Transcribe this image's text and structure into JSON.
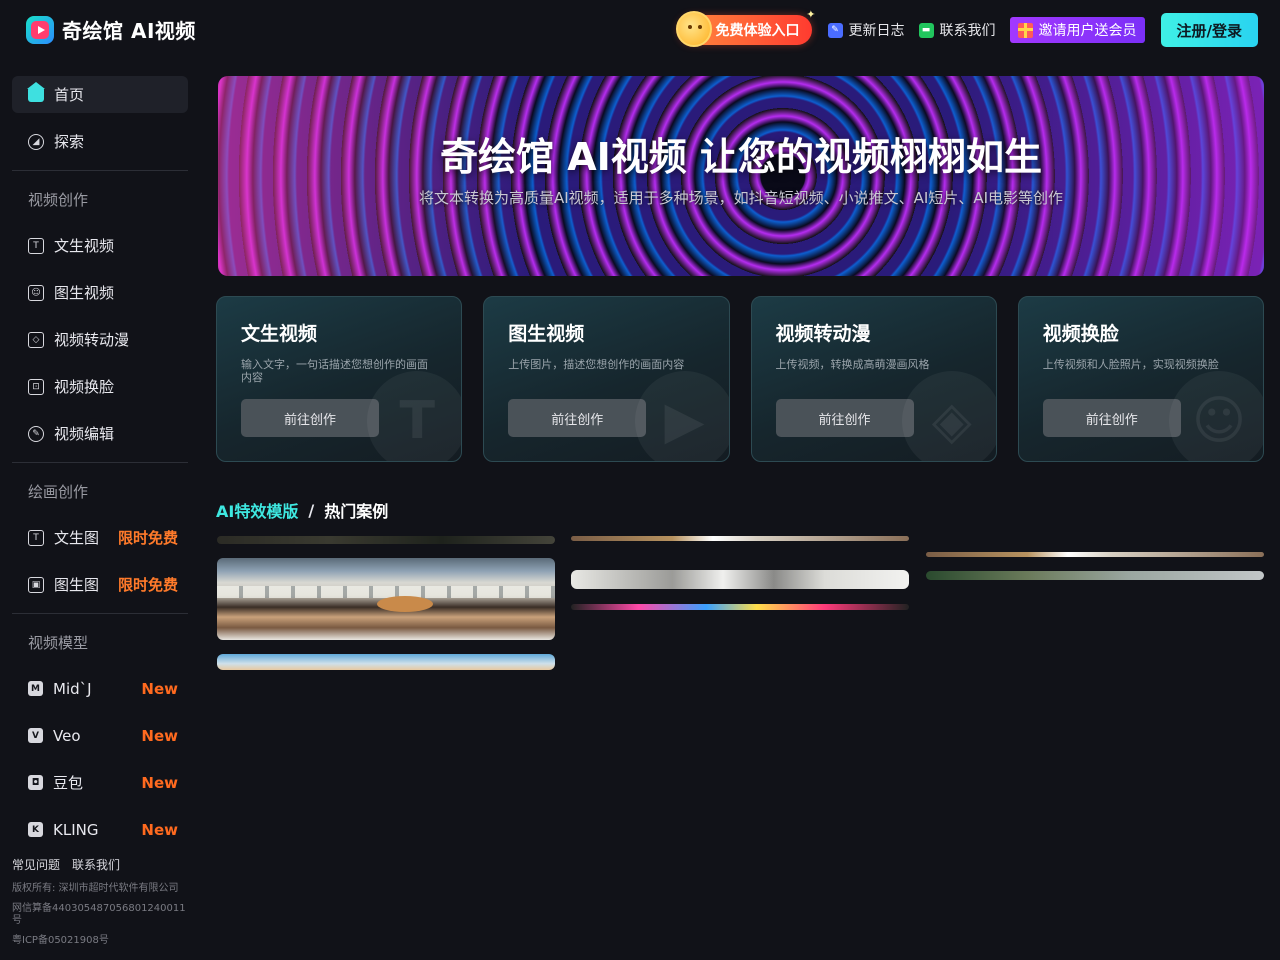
{
  "header": {
    "logo_text": "奇绘馆 AI视频",
    "free_entry": "免费体验入口",
    "changelog": "更新日志",
    "contact": "联系我们",
    "invite": "邀请用户送会员",
    "login": "注册/登录"
  },
  "sidebar": {
    "top_items": [
      {
        "label": "首页",
        "icon": "home-icon",
        "active": true
      },
      {
        "label": "探索",
        "icon": "compass-icon"
      }
    ],
    "video_heading": "视频创作",
    "video_items": [
      {
        "label": "文生视频",
        "icon": "text-t-icon"
      },
      {
        "label": "图生视频",
        "icon": "image-icon"
      },
      {
        "label": "视频转动漫",
        "icon": "anime-icon"
      },
      {
        "label": "视频换脸",
        "icon": "face-scan-icon"
      },
      {
        "label": "视频编辑",
        "icon": "edit-pen-icon"
      }
    ],
    "paint_heading": "绘画创作",
    "paint_items": [
      {
        "label": "文生图",
        "badge": "限时免费",
        "icon": "text-image-icon"
      },
      {
        "label": "图生图",
        "badge": "限时免费",
        "icon": "image-image-icon"
      }
    ],
    "model_heading": "视频模型",
    "model_items": [
      {
        "label": "Mid`J",
        "badge": "New",
        "glyph": "M"
      },
      {
        "label": "Veo",
        "badge": "New",
        "glyph": "V"
      },
      {
        "label": "豆包",
        "badge": "New",
        "glyph": "◘"
      },
      {
        "label": "KLING",
        "badge": "New",
        "glyph": "K"
      }
    ],
    "footer": {
      "faq": "常见问题",
      "contact": "联系我们",
      "copyright": "版权所有: 深圳市超时代软件有限公司",
      "netcredit": "网信算备440305487056801240011号",
      "icp": "粤ICP备05021908号"
    }
  },
  "banner": {
    "title": "奇绘馆 AI视频 让您的视频栩栩如生",
    "subtitle": "将文本转换为高质量AI视频，适用于多种场景，如抖音短视频、小说推文、AI短片、AI电影等创作"
  },
  "cards": [
    {
      "title": "文生视频",
      "desc": "输入文字，一句话描述您想创作的画面内容",
      "button": "前往创作",
      "deco": "T"
    },
    {
      "title": "图生视频",
      "desc": "上传图片，描述您想创作的画面内容",
      "button": "前往创作",
      "deco": "▶"
    },
    {
      "title": "视频转动漫",
      "desc": "上传视频，转换成高萌漫画风格",
      "button": "前往创作",
      "deco": "◈"
    },
    {
      "title": "视频换脸",
      "desc": "上传视频和人脸照片，实现视频换脸",
      "button": "前往创作",
      "deco": "☺"
    }
  ],
  "gallery_tabs": {
    "active": "AI特效模版",
    "separator": "/",
    "other": "热门案例"
  }
}
